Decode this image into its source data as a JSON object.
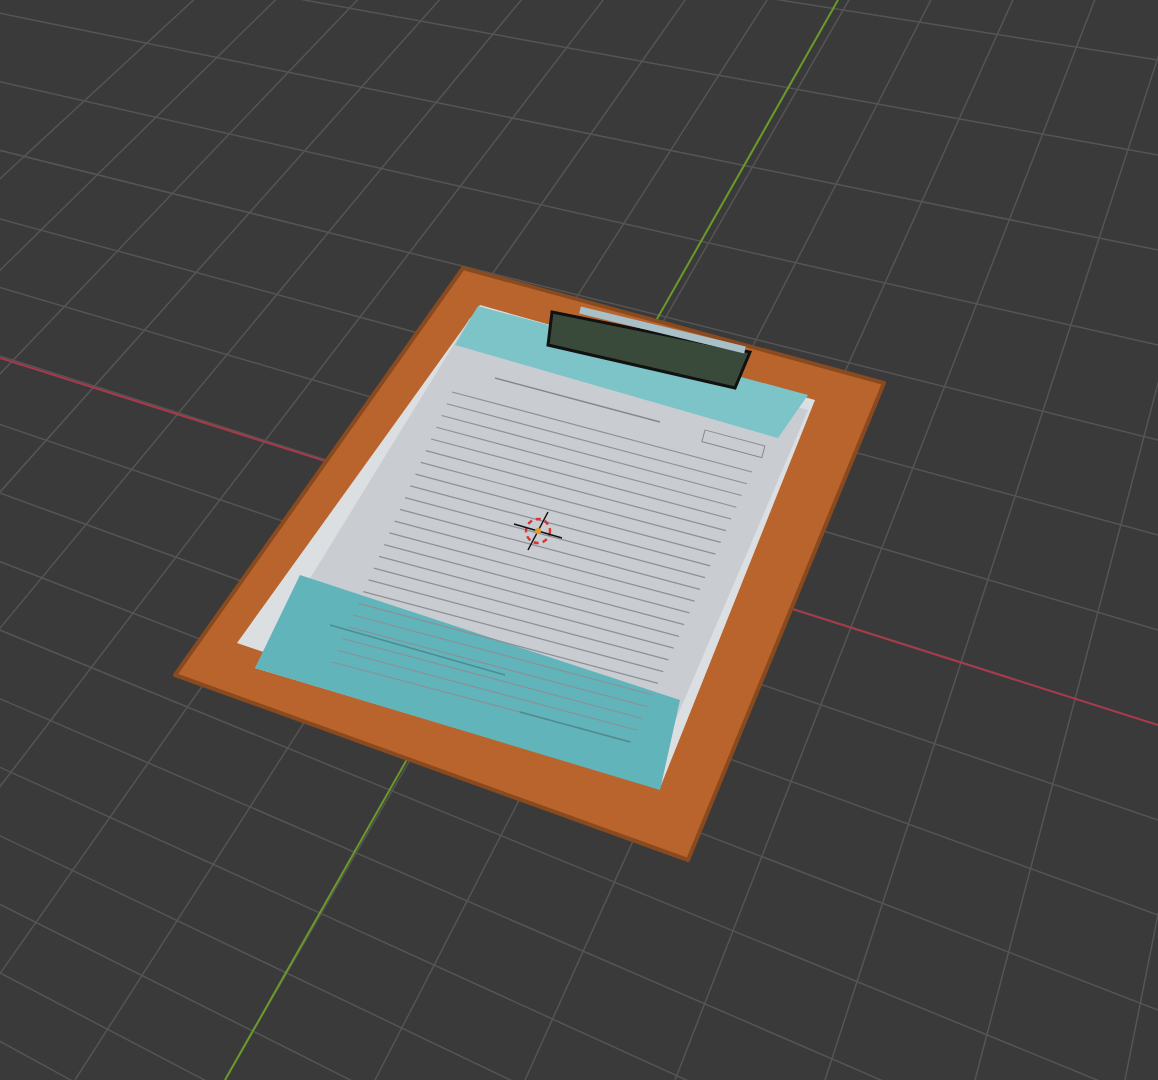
{
  "viewport": {
    "overlays": {
      "grid": true,
      "axis_x": true,
      "axis_y": true,
      "cursor": true
    }
  }
}
